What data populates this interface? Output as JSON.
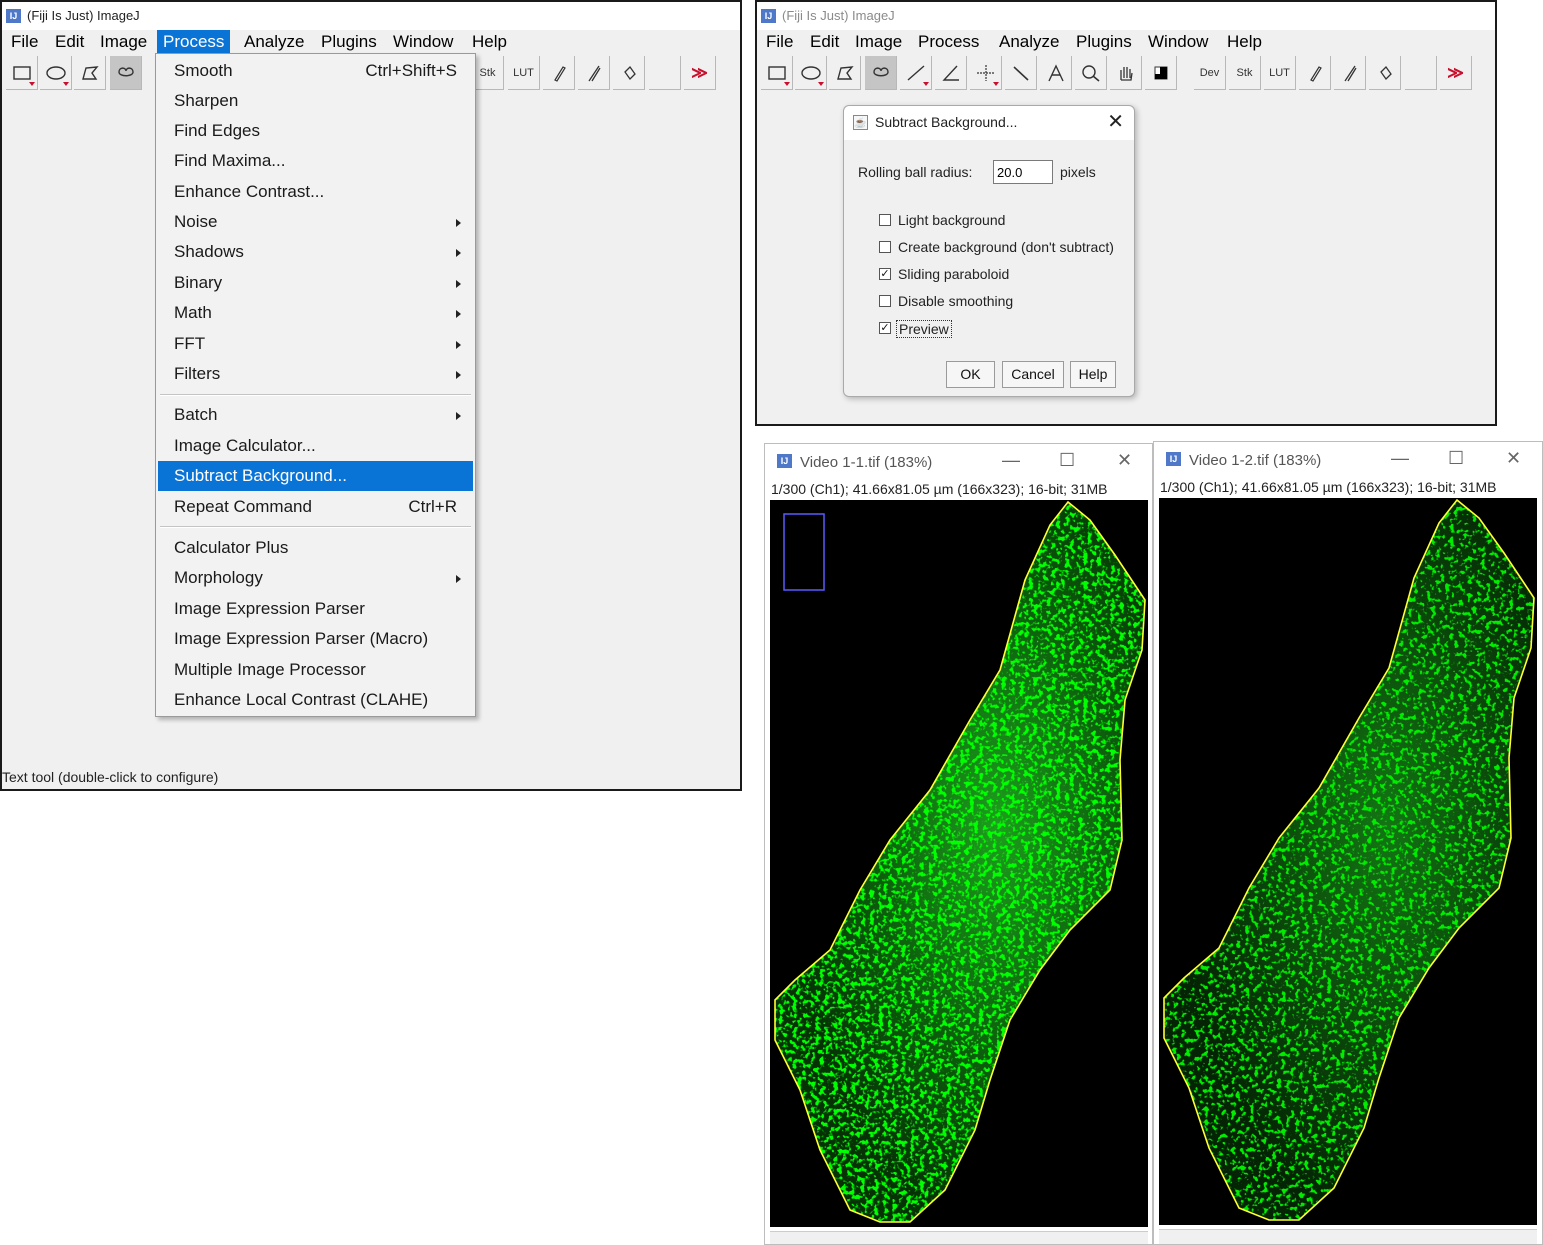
{
  "left_window": {
    "title": "(Fiji Is Just) ImageJ",
    "menu": [
      "File",
      "Edit",
      "Image",
      "Process",
      "Analyze",
      "Plugins",
      "Window",
      "Help"
    ],
    "active_menu": "Process",
    "toolbar_text": {
      "stk": "Stk",
      "lut": "LUT"
    },
    "status": "Text tool (double-click to configure)"
  },
  "process_menu": {
    "items": [
      {
        "label": "Smooth",
        "shortcut": "Ctrl+Shift+S"
      },
      {
        "label": "Sharpen"
      },
      {
        "label": "Find Edges"
      },
      {
        "label": "Find Maxima..."
      },
      {
        "label": "Enhance Contrast..."
      },
      {
        "label": "Noise",
        "submenu": true
      },
      {
        "label": "Shadows",
        "submenu": true
      },
      {
        "label": "Binary",
        "submenu": true
      },
      {
        "label": "Math",
        "submenu": true
      },
      {
        "label": "FFT",
        "submenu": true
      },
      {
        "label": "Filters",
        "submenu": true
      },
      {
        "label": "Batch",
        "submenu": true
      },
      {
        "label": "Image Calculator..."
      },
      {
        "label": "Subtract Background...",
        "highlighted": true
      },
      {
        "label": "Repeat Command",
        "shortcut": "Ctrl+R"
      },
      {
        "label": "Calculator Plus"
      },
      {
        "label": "Morphology",
        "submenu": true
      },
      {
        "label": "Image Expression Parser"
      },
      {
        "label": "Image Expression Parser (Macro)"
      },
      {
        "label": "Multiple Image Processor"
      },
      {
        "label": "Enhance Local Contrast (CLAHE)"
      }
    ]
  },
  "right_window": {
    "title": "(Fiji Is Just) ImageJ",
    "menu": [
      "File",
      "Edit",
      "Image",
      "Process",
      "Analyze",
      "Plugins",
      "Window",
      "Help"
    ],
    "toolbar_text": {
      "dev": "Dev",
      "stk": "Stk",
      "lut": "LUT"
    }
  },
  "dialog": {
    "title": "Subtract Background...",
    "radius_label": "Rolling ball radius:",
    "radius_value": "20.0",
    "radius_unit": "pixels",
    "options": [
      {
        "label": "Light background",
        "checked": false
      },
      {
        "label": "Create background (don't subtract)",
        "checked": false
      },
      {
        "label": "Sliding paraboloid",
        "checked": true
      },
      {
        "label": "Disable smoothing",
        "checked": false
      },
      {
        "label": "Preview",
        "checked": true
      }
    ],
    "buttons": {
      "ok": "OK",
      "cancel": "Cancel",
      "help": "Help"
    }
  },
  "image_windows": [
    {
      "title": "Video 1-1.tif (183%)",
      "info": "1/300 (Ch1); 41.66x81.05 µm (166x323); 16-bit; 31MB",
      "brightness": "bright",
      "has_roi_box": true
    },
    {
      "title": "Video 1-2.tif (183%)",
      "info": "1/300 (Ch1); 41.66x81.05 µm (166x323); 16-bit; 31MB",
      "brightness": "dim",
      "has_roi_box": false
    }
  ],
  "colors": {
    "accent": "#0a74d6",
    "roi_outline": "#ffff33",
    "signal": "#22dd22",
    "close_red": "#c8102e"
  }
}
